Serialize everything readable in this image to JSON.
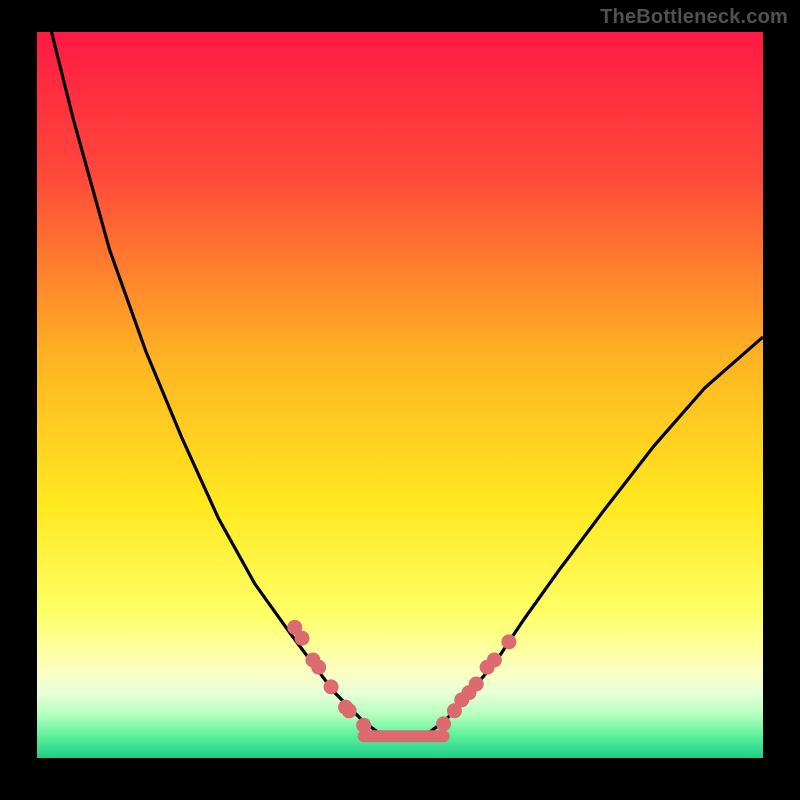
{
  "watermark": "TheBottleneck.com",
  "chart_data": {
    "type": "line",
    "title": "",
    "xlabel": "",
    "ylabel": "",
    "xlim": [
      0,
      100
    ],
    "ylim": [
      0,
      100
    ],
    "gradient_stops": [
      {
        "offset": 0,
        "color": "#ff1a44"
      },
      {
        "offset": 20,
        "color": "#ff4a3a"
      },
      {
        "offset": 45,
        "color": "#ffb423"
      },
      {
        "offset": 65,
        "color": "#ffe81f"
      },
      {
        "offset": 80,
        "color": "#ffff66"
      },
      {
        "offset": 88,
        "color": "#fcffc0"
      },
      {
        "offset": 91,
        "color": "#e8ffd8"
      },
      {
        "offset": 94,
        "color": "#b4ffc0"
      },
      {
        "offset": 97,
        "color": "#5cf09a"
      },
      {
        "offset": 100,
        "color": "#1ccd88"
      }
    ],
    "series": [
      {
        "name": "curve",
        "type": "line",
        "x": [
          2,
          5,
          10,
          15,
          20,
          25,
          30,
          35,
          38,
          41,
          43,
          45,
          47,
          48.5,
          50,
          52,
          54,
          56,
          58,
          60,
          63,
          67,
          72,
          78,
          85,
          92,
          100
        ],
        "y": [
          100,
          88,
          70,
          56,
          44,
          33,
          24,
          17,
          13,
          9,
          7,
          5,
          3.5,
          3,
          3,
          3,
          3.5,
          5,
          7,
          9.5,
          13,
          19,
          26,
          34,
          43,
          51,
          58
        ]
      },
      {
        "name": "left-dots",
        "type": "scatter",
        "x": [
          35.5,
          36.5,
          38.0,
          38.8,
          40.5,
          42.5,
          43.0,
          45.0
        ],
        "y": [
          18.0,
          16.5,
          13.5,
          12.5,
          9.8,
          7.0,
          6.5,
          4.5
        ]
      },
      {
        "name": "right-dots",
        "type": "scatter",
        "x": [
          56.0,
          57.5,
          58.5,
          59.5,
          60.5,
          62.0,
          63.0,
          65.0
        ],
        "y": [
          4.7,
          6.5,
          8.0,
          9.0,
          10.2,
          12.5,
          13.5,
          16.0
        ]
      },
      {
        "name": "flat-segment",
        "type": "line",
        "x": [
          45.0,
          56.0
        ],
        "y": [
          3.0,
          3.0
        ]
      }
    ],
    "colors": {
      "curve": "#000000",
      "dots": "#db6b6e",
      "flat_segment": "#db6b6e"
    }
  }
}
